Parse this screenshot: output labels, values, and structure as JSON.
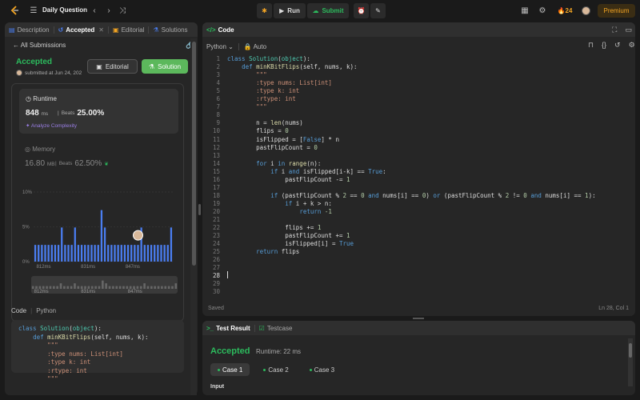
{
  "nav": {
    "title": "Daily Question",
    "run": "Run",
    "submit": "Submit",
    "streak": "24",
    "premium": "Premium"
  },
  "left_tabs": [
    {
      "label": "Description"
    },
    {
      "label": "Accepted"
    },
    {
      "label": "Editorial"
    },
    {
      "label": "Solutions"
    }
  ],
  "submission": {
    "back": "All Submissions",
    "status": "Accepted",
    "submitted": "submitted at Jun 24, 202",
    "editorial_btn": "Editorial",
    "solution_btn": "Solution",
    "runtime_label": "Runtime",
    "runtime_value": "848",
    "runtime_unit": "ms",
    "runtime_beats_label": "Beats",
    "runtime_beats": "25.00%",
    "analyze": "Analyze Complexity",
    "memory_label": "Memory",
    "memory_value": "16.80",
    "memory_unit": "MB",
    "memory_beats_label": "Beats",
    "memory_beats": "62.50%"
  },
  "chart_data": {
    "type": "bar",
    "yticks": [
      "10%",
      "5%",
      "0%"
    ],
    "xticks": [
      "812ms",
      "831ms",
      "847ms"
    ],
    "mini_xticks": [
      "812ms",
      "831ms",
      "847ms"
    ],
    "ylim": [
      0,
      10
    ],
    "values": [
      2.4,
      2.4,
      2.4,
      2.4,
      2.4,
      2.4,
      2.4,
      2.4,
      4.9,
      2.4,
      2.4,
      2.4,
      4.9,
      2.4,
      2.4,
      2.4,
      2.4,
      2.4,
      2.4,
      2.4,
      7.4,
      4.9,
      2.4,
      2.4,
      2.4,
      2.4,
      2.4,
      2.4,
      2.4,
      2.4,
      2.4,
      2.4,
      4.9,
      2.4,
      2.4,
      2.4,
      2.4,
      2.4,
      2.4,
      2.4,
      2.4,
      4.9
    ],
    "highlight_index": 31,
    "bar_color": "#4a7df0"
  },
  "left_code": {
    "header": "Code",
    "lang": "Python",
    "lines": [
      "class Solution(object):",
      "    def minKBitFlips(self, nums, k):",
      "        \"\"\"",
      "        :type nums: List[int]",
      "        :type k: int",
      "        :rtype: int",
      "        \"\"\""
    ]
  },
  "code_panel": {
    "title": "Code",
    "lang": "Python",
    "auto": "Auto",
    "saved": "Saved",
    "position": "Ln 28, Col 1",
    "lines": [
      "class Solution(object):",
      "    def minKBitFlips(self, nums, k):",
      "        \"\"\"",
      "        :type nums: List[int]",
      "        :type k: int",
      "        :rtype: int",
      "        \"\"\"",
      "",
      "        n = len(nums)",
      "        flips = 0",
      "        isFlipped = [False] * n",
      "        pastFlipCount = 0",
      "",
      "        for i in range(n):",
      "            if i and isFlipped[i-k] == True:",
      "                pastFlipCount -= 1",
      "",
      "            if (pastFlipCount % 2 == 0 and nums[i] == 0) or (pastFlipCount % 2 != 0 and nums[i] == 1):",
      "                if i + k > n:",
      "                    return -1",
      "",
      "                flips += 1",
      "                pastFlipCount += 1",
      "                isFlipped[i] = True",
      "        return flips",
      "",
      "",
      "",
      "",
      ""
    ]
  },
  "test_panel": {
    "tab1": "Test Result",
    "tab2": "Testcase",
    "status": "Accepted",
    "runtime": "Runtime: 22 ms",
    "cases": [
      "Case 1",
      "Case 2",
      "Case 3"
    ],
    "input_label": "Input"
  }
}
